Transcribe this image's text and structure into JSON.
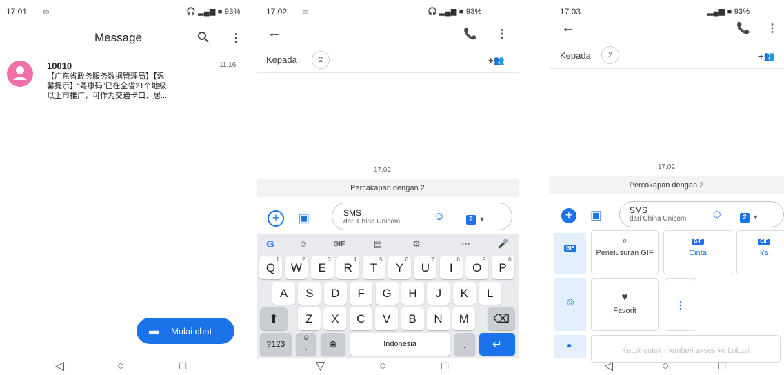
{
  "screen1": {
    "status_time": "17.01",
    "status_right": "93%",
    "title": "Message",
    "conversation": {
      "sender": "10010",
      "time": "11.16",
      "preview_line1": "【广东省政务服务数据管理局】【温",
      "preview_line2": "馨提示】“粤康码”已在全省21个地级",
      "preview_line3": "以上市推广，可作为交通卡口、居..."
    },
    "fab_label": "Mulai chat",
    "nav": [
      "◁",
      "○",
      "□"
    ]
  },
  "screen2": {
    "status_time": "17.02",
    "status_right": "93%",
    "to_label": "Kepada",
    "recipient_count": "2",
    "timestamp": "17.02",
    "banner": "Percakapan dengan 2",
    "compose_title": "SMS",
    "compose_subtitle": "dari China Unicom",
    "sim_number": "2",
    "toolbar_gif": "GIF",
    "keyboard": {
      "row1": [
        {
          "k": "Q",
          "n": "1"
        },
        {
          "k": "W",
          "n": "2"
        },
        {
          "k": "E",
          "n": "3"
        },
        {
          "k": "R",
          "n": "4"
        },
        {
          "k": "T",
          "n": "5"
        },
        {
          "k": "Y",
          "n": "6"
        },
        {
          "k": "U",
          "n": "7"
        },
        {
          "k": "I",
          "n": "8"
        },
        {
          "k": "O",
          "n": "9"
        },
        {
          "k": "P",
          "n": "0"
        }
      ],
      "row2": [
        "A",
        "S",
        "D",
        "F",
        "G",
        "H",
        "J",
        "K",
        "L"
      ],
      "row3": [
        "Z",
        "X",
        "C",
        "V",
        "B",
        "N",
        "M"
      ],
      "symbols_key": "?123",
      "space_label": "Indonesia",
      "period_key": "."
    },
    "nav": [
      "▽",
      "○",
      "□"
    ]
  },
  "screen3": {
    "status_time": "17.03",
    "status_right": "93%",
    "to_label": "Kepada",
    "recipient_count": "2",
    "timestamp": "17.02",
    "banner": "Percakapan dengan 2",
    "compose_title": "SMS",
    "compose_subtitle": "dari China Unicom",
    "sim_number": "2",
    "gif_badge": "GIF",
    "picker": {
      "search_gif": "Penelusuran GIF",
      "cinta": "Cinta",
      "ya": "Ya",
      "favorit": "Favorit",
      "location_hint": "Ketuk untuk memberi akses ke Lokasi"
    },
    "nav": [
      "◁",
      "○",
      "□"
    ]
  },
  "colors": {
    "accent": "#1a73e8",
    "avatar": "#f06fa8"
  }
}
